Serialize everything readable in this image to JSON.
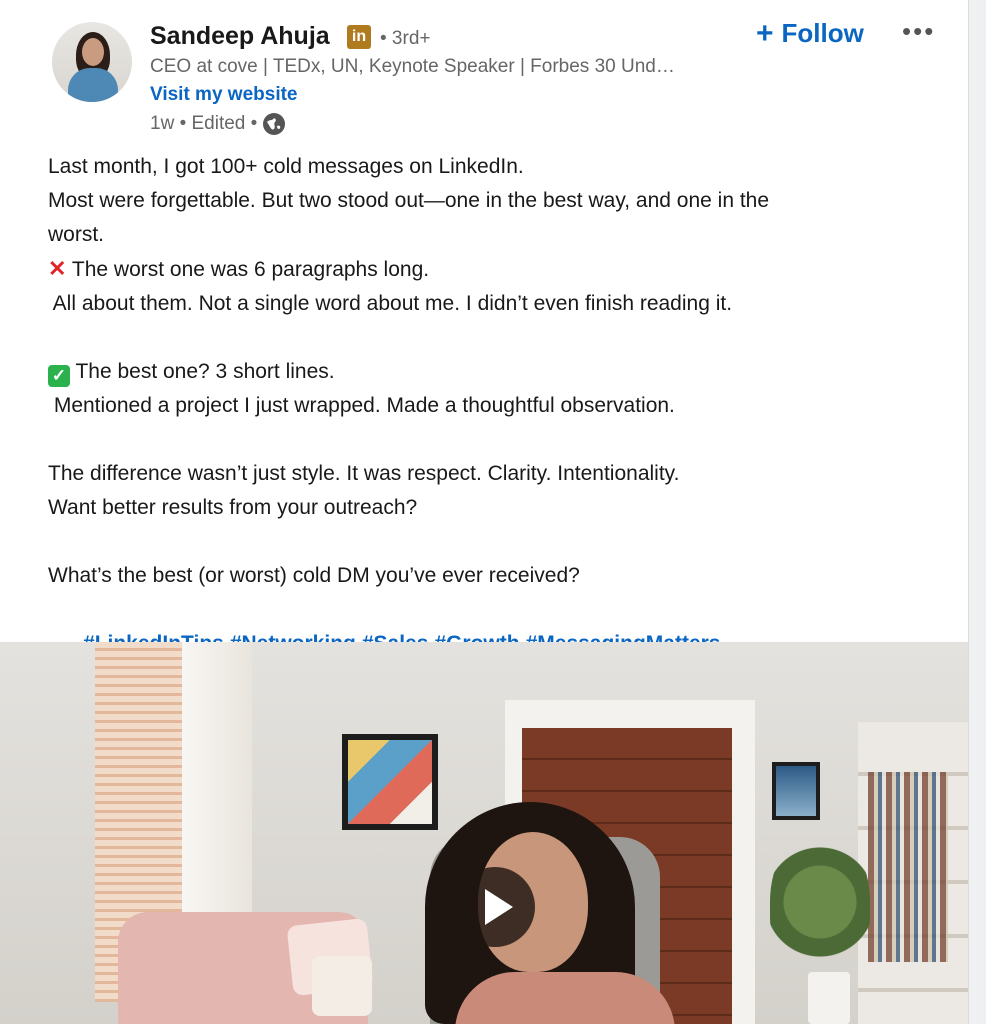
{
  "author": {
    "name": "Sandeep Ahuja",
    "badge": "in",
    "degree": "• 3rd+",
    "headline": "CEO at cove | TEDx, UN, Keynote Speaker | Forbes 30 Und…",
    "website_label": "Visit my website",
    "meta": "1w • Edited •"
  },
  "actions": {
    "follow_plus": "+",
    "follow_label": "Follow",
    "more_label": "•••"
  },
  "post": {
    "line1": "Last month, I got 100+ cold messages on LinkedIn.",
    "line2": "Most were forgettable. But two stood out—one in the best way, and one in the",
    "line3": "worst.",
    "x_emoji": "✕",
    "line4": " The worst one was 6 paragraphs long.",
    "line5": " All about them. Not a single word about me. I didn’t even finish reading it.",
    "check_emoji": "✓",
    "line6": " The best one? 3 short lines.",
    "line7": " Mentioned a project I just wrapped. Made a thoughtful observation.",
    "line8": "The difference wasn’t just style. It was respect. Clarity. Intentionality.",
    "line9": "Want better results from your outreach?",
    "line10": "What’s the best (or worst) cold DM you’ve ever received?",
    "hashtags": [
      "#LinkedInTips",
      "#Networking",
      "#Sales",
      "#Growth",
      "#MessagingMatters"
    ]
  },
  "colors": {
    "link_blue": "#0a66c2",
    "badge_gold": "#b07a1e",
    "meta_gray": "#666666"
  },
  "icons": {
    "badge": "linkedin-premium-icon",
    "visibility": "globe-icon",
    "video": "play-icon"
  }
}
